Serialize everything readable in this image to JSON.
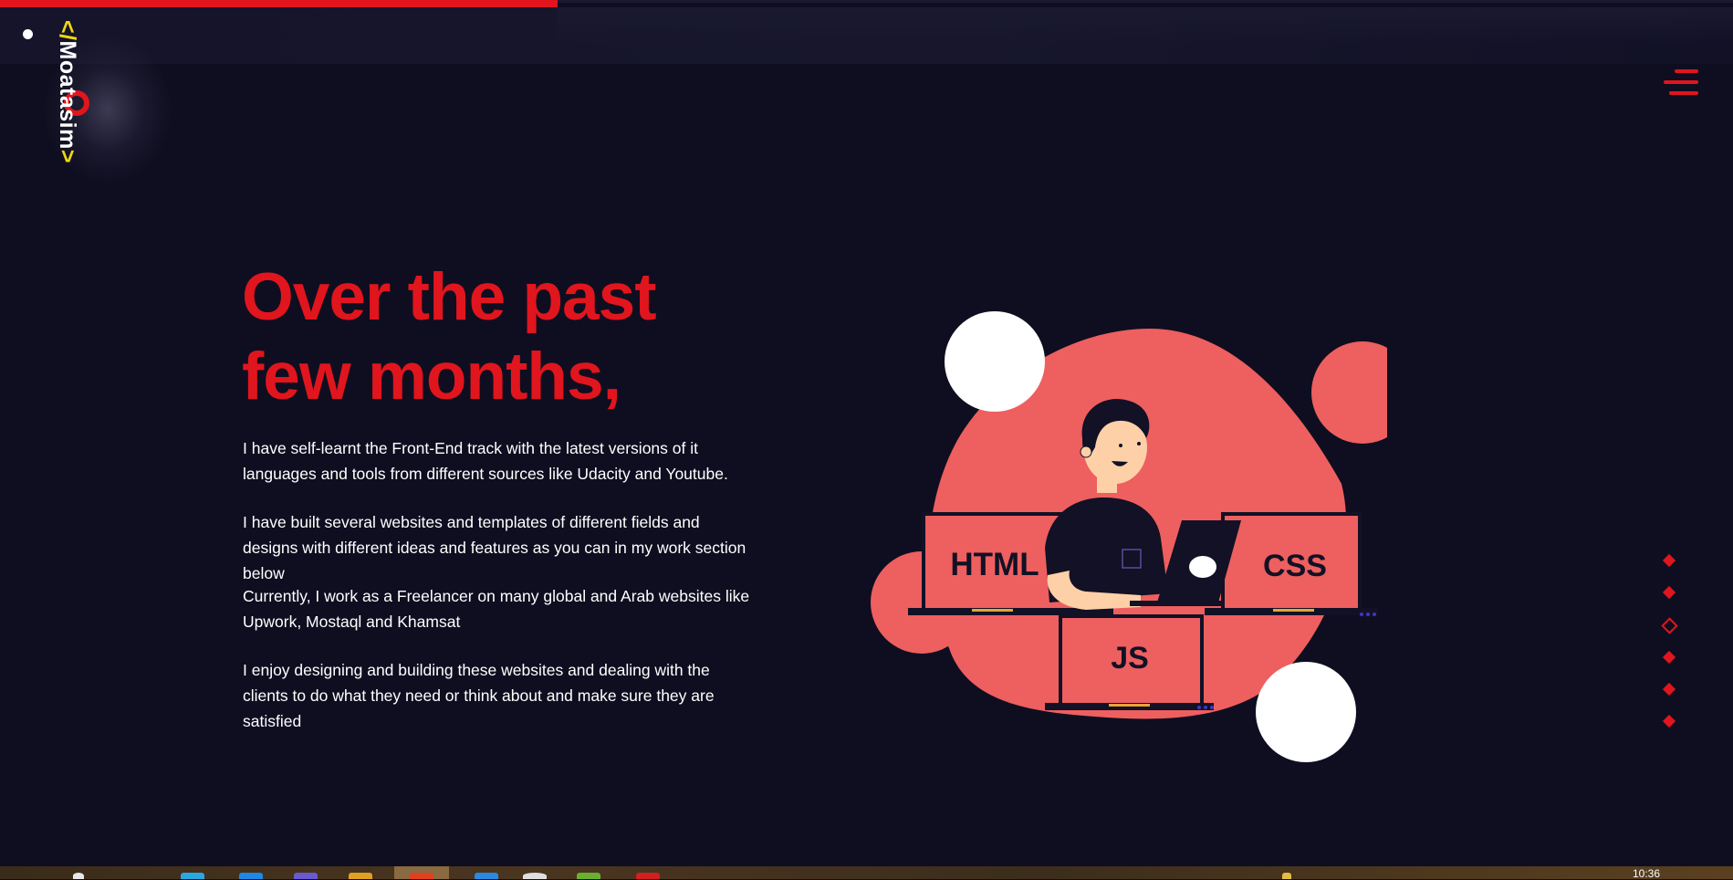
{
  "logo": {
    "open": "</",
    "name": "Moatasim",
    "close": ">"
  },
  "menu": {
    "icon": "hamburger-menu-icon"
  },
  "hero": {
    "headline_line1": "Over the past",
    "headline_line2": "few months,",
    "paragraphs": [
      "I have self-learnt the Front-End track with the latest versions of it languages and tools from different sources like Udacity and Youtube.",
      "I have built several websites and templates of different fields and designs with different ideas and features as you can in my work section below",
      "Currently, I work as a Freelancer on many global and Arab websites like Upwork, Mostaql and Khamsat",
      "I enjoy designing and building these websites and dealing with the clients to do what they need or think about and make sure they are satisfied"
    ]
  },
  "illustration": {
    "labels": [
      "HTML",
      "CSS",
      "JS"
    ]
  },
  "section_nav": {
    "count": 6,
    "active_index": 2
  },
  "scroll_progress": 0.322,
  "taskbar": {
    "clock": "10:36"
  },
  "colors": {
    "accent": "#e1151d",
    "background": "#0f0e20",
    "coral": "#ee5f5f",
    "logo_bracket": "#f0d80f"
  }
}
